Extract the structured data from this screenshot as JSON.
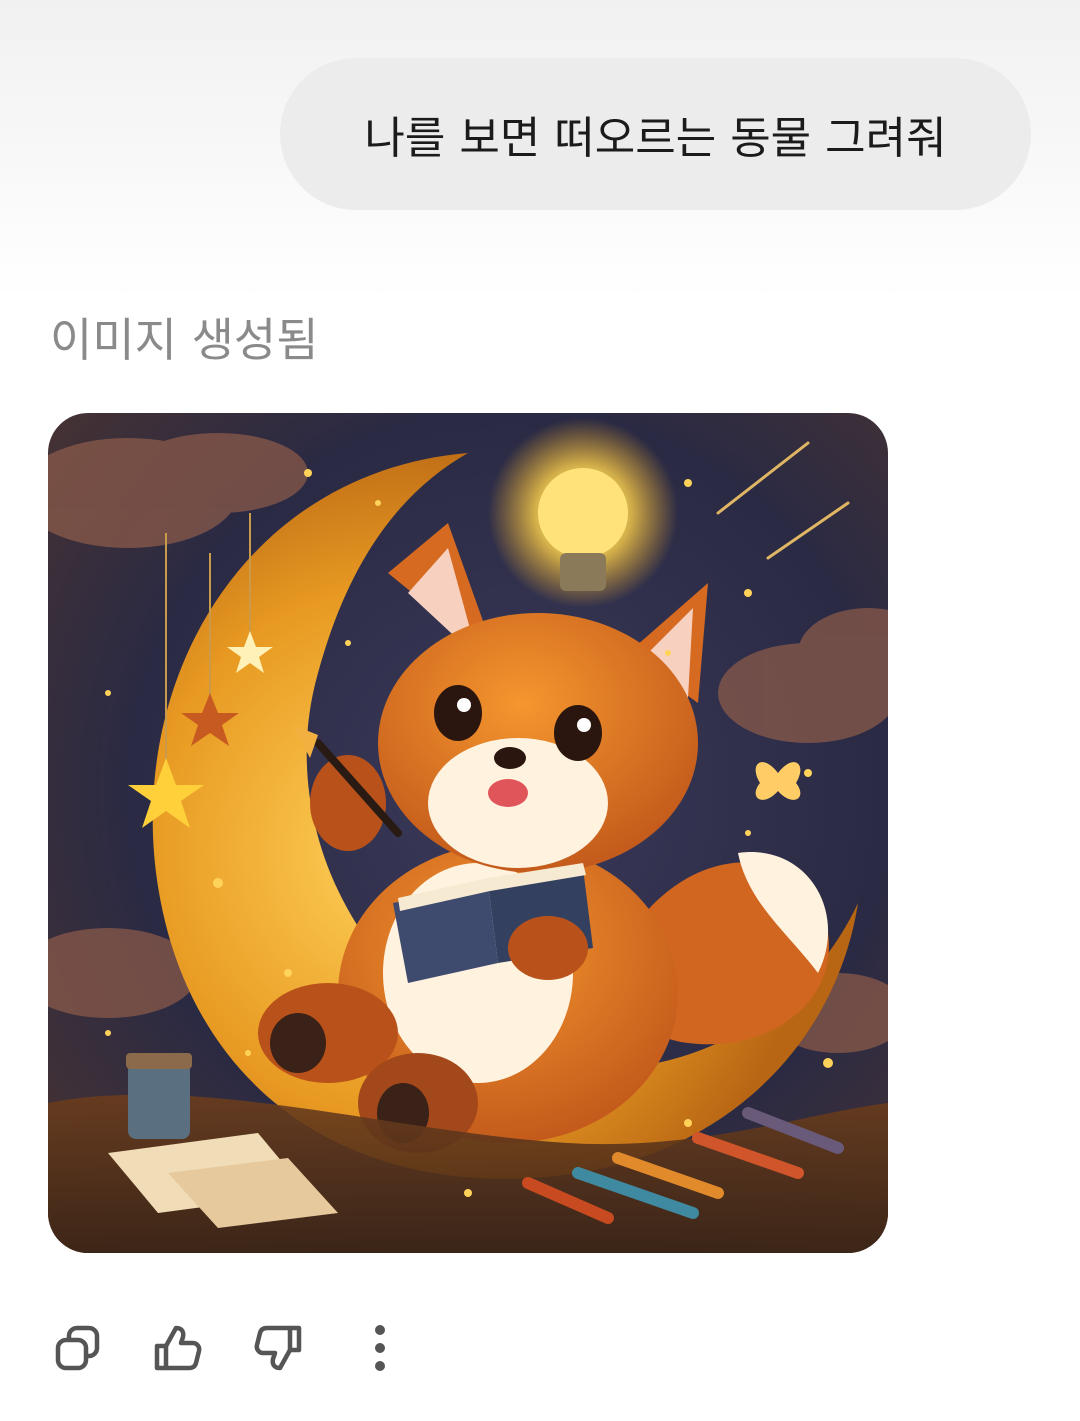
{
  "user_message": {
    "text": "나를 보면 떠오르는 동물 그려줘"
  },
  "assistant": {
    "status_label": "이미지 생성됨",
    "image": {
      "subject": "fox-on-crescent-moon-illustration"
    },
    "actions": [
      {
        "icon": "copy-icon"
      },
      {
        "icon": "thumbs-up-icon"
      },
      {
        "icon": "thumbs-down-icon"
      },
      {
        "icon": "more-vertical-icon"
      }
    ]
  },
  "colors": {
    "bubble_bg": "#ececec",
    "text_primary": "#1b1b1b",
    "text_muted": "#8a8a8a",
    "icon": "#555555"
  }
}
